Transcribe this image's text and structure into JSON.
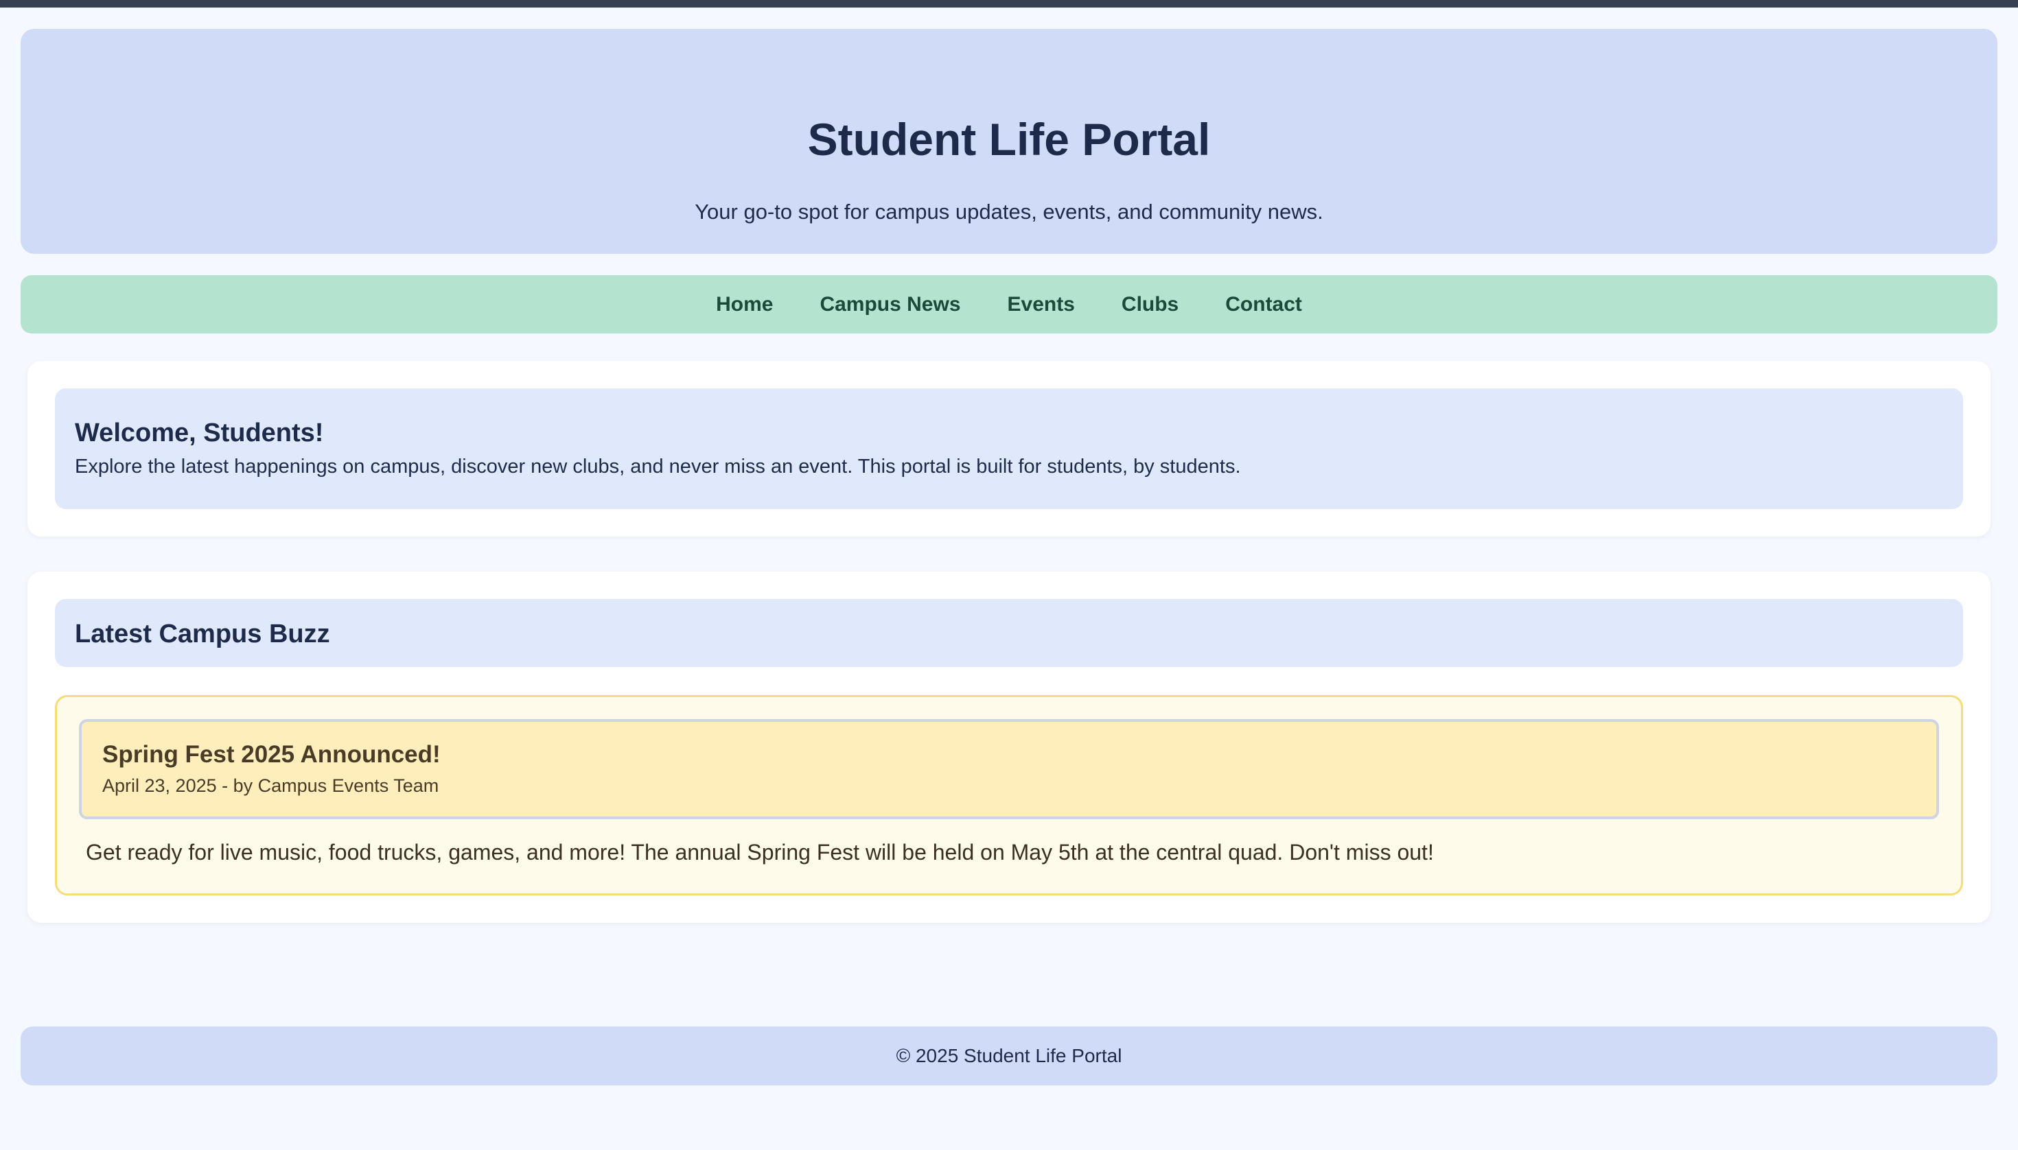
{
  "header": {
    "title": "Student Life Portal",
    "tagline": "Your go-to spot for campus updates, events, and community news."
  },
  "nav": {
    "items": [
      {
        "label": "Home"
      },
      {
        "label": "Campus News"
      },
      {
        "label": "Events"
      },
      {
        "label": "Clubs"
      },
      {
        "label": "Contact"
      }
    ]
  },
  "welcome": {
    "heading": "Welcome, Students!",
    "text": "Explore the latest happenings on campus, discover new clubs, and never miss an event. This portal is built for students, by students."
  },
  "buzz": {
    "heading": "Latest Campus Buzz",
    "posts": [
      {
        "title": "Spring Fest 2025 Announced!",
        "meta": "April 23, 2025 - by Campus Events Team",
        "body": "Get ready for live music, food trucks, games, and more! The annual Spring Fest will be held on May 5th at the central quad. Don't miss out!"
      }
    ]
  },
  "footer": {
    "copyright": "© 2025 Student Life Portal"
  },
  "colors": {
    "header_bg": "#d0dbf7",
    "nav_bg": "#b4e4d0",
    "nav_text": "#1a4a3a",
    "section_bg": "#dfe9fb",
    "news_bg": "#fffbea",
    "news_header_bg": "#feeebb",
    "news_border": "#f6dc7c",
    "top_bar": "#374151"
  }
}
